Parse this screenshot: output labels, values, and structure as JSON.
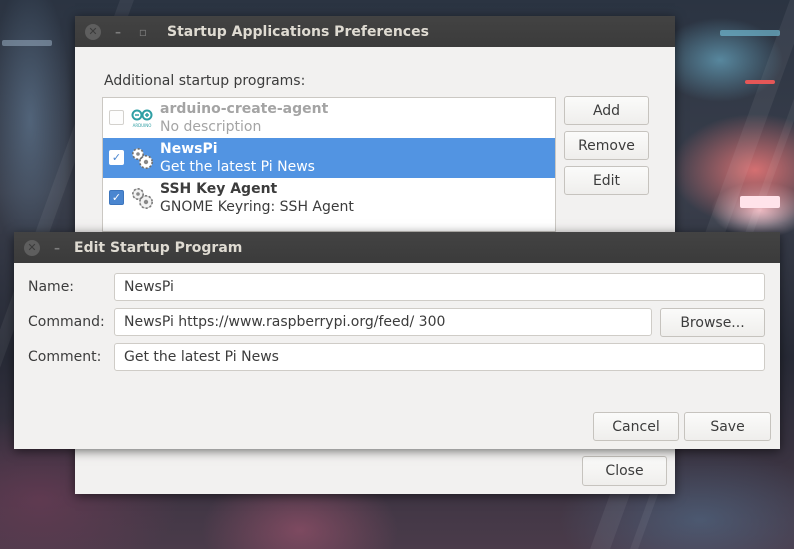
{
  "startup_window": {
    "title": "Startup Applications Preferences",
    "section_label": "Additional startup programs:",
    "programs": [
      {
        "name": "arduino-create-agent",
        "description": "No description",
        "enabled": false,
        "icon": "arduino-icon",
        "icon_caption": "ARDUINO"
      },
      {
        "name": "NewsPi",
        "description": "Get the latest Pi News",
        "enabled": true,
        "icon": "gears-icon"
      },
      {
        "name": "SSH Key Agent",
        "description": "GNOME Keyring: SSH Agent",
        "enabled": true,
        "icon": "gears-icon"
      }
    ],
    "buttons": {
      "add": "Add",
      "remove": "Remove",
      "edit": "Edit",
      "close": "Close"
    }
  },
  "edit_window": {
    "title": "Edit Startup Program",
    "fields": {
      "name_label": "Name:",
      "name_value": "NewsPi",
      "command_label": "Command:",
      "command_value": "NewsPi https://www.raspberrypi.org/feed/ 300",
      "comment_label": "Comment:",
      "comment_value": "Get the latest Pi News"
    },
    "buttons": {
      "browse": "Browse...",
      "cancel": "Cancel",
      "save": "Save"
    }
  },
  "colors": {
    "selection": "#5294e2",
    "titlebar": "#3b3b3b",
    "window_bg": "#f2f1f0"
  }
}
